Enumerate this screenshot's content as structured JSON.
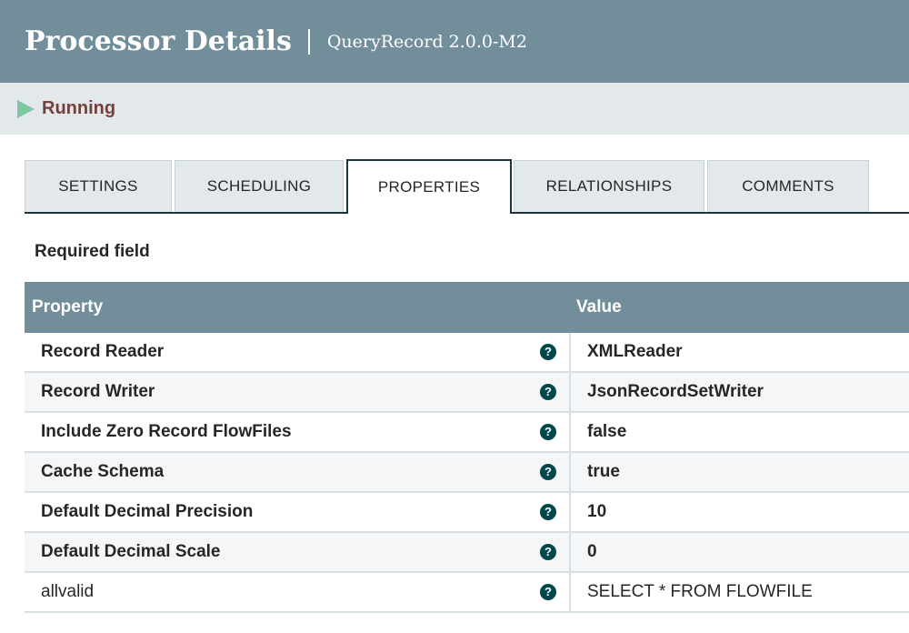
{
  "header": {
    "title": "Processor Details",
    "subtitle": "QueryRecord 2.0.0-M2"
  },
  "status": {
    "icon": "play-icon",
    "label": "Running",
    "icon_color": "#7dc7a0",
    "label_color": "#75403c"
  },
  "tabs": [
    {
      "label": "SETTINGS",
      "active": false
    },
    {
      "label": "SCHEDULING",
      "active": false
    },
    {
      "label": "PROPERTIES",
      "active": true
    },
    {
      "label": "RELATIONSHIPS",
      "active": false
    },
    {
      "label": "COMMENTS",
      "active": false
    }
  ],
  "required_label": "Required field",
  "table": {
    "columns": {
      "property": "Property",
      "value": "Value"
    },
    "rows": [
      {
        "property": "Record Reader",
        "value": "XMLReader",
        "required": true
      },
      {
        "property": "Record Writer",
        "value": "JsonRecordSetWriter",
        "required": true
      },
      {
        "property": "Include Zero Record FlowFiles",
        "value": "false",
        "required": true
      },
      {
        "property": "Cache Schema",
        "value": "true",
        "required": true
      },
      {
        "property": "Default Decimal Precision",
        "value": "10",
        "required": true
      },
      {
        "property": "Default Decimal Scale",
        "value": "0",
        "required": true
      },
      {
        "property": "allvalid",
        "value": "SELECT * FROM FLOWFILE",
        "required": false
      }
    ],
    "help_icon": "?"
  },
  "colors": {
    "header_bg": "#728e9b",
    "accent": "#004849",
    "tab_border": "#1a3440"
  }
}
